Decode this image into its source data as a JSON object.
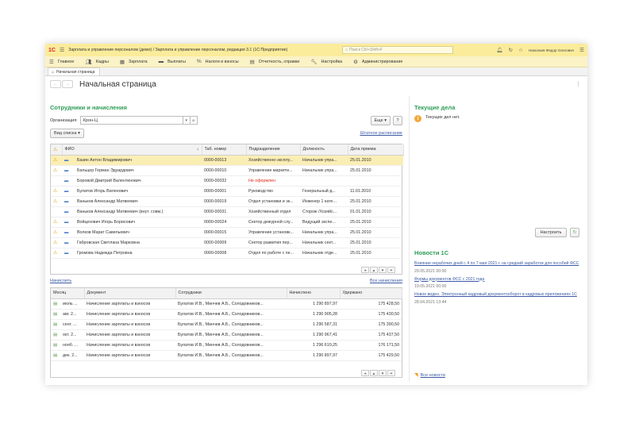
{
  "window": {
    "title": "Зарплата и управление персоналом (демо) / Зарплата и управление персоналом, редакция 3.1  (1С:Предприятие)",
    "search_placeholder": "Поиск Ctrl+Shift+F",
    "user": "Николаев Федор Олегович"
  },
  "menu": [
    {
      "icon": "menu-icon",
      "label": "Главное"
    },
    {
      "icon": "people-icon",
      "label": "Кадры"
    },
    {
      "icon": "calculator-icon",
      "label": "Зарплата"
    },
    {
      "icon": "card-icon",
      "label": "Выплаты"
    },
    {
      "icon": "percent-icon",
      "label": "Налоги и взносы"
    },
    {
      "icon": "report-icon",
      "label": "Отчетность, справки"
    },
    {
      "icon": "wrench-icon",
      "label": "Настройка"
    },
    {
      "icon": "gear-icon",
      "label": "Администрирование"
    }
  ],
  "tab": {
    "label": "Начальная страница"
  },
  "page": {
    "title": "Начальная страница"
  },
  "employees": {
    "title": "Сотрудники и начисления",
    "org_label": "Организация:",
    "org_value": "Крон-Ц",
    "more_button": "Еще",
    "help_button": "?",
    "view_button": "Вид списка",
    "staff_link": "Штатное расписание",
    "columns": [
      "",
      "ФИО",
      "Таб. номер",
      "Подразделение",
      "Должность",
      "Дата приема"
    ],
    "rows": [
      {
        "mark": "warn",
        "name": "Базин Антон Владимирович",
        "num": "0000-00013",
        "dept": "Хозяйственно-эксплу...",
        "pos": "Начальник упра...",
        "date": "25.01.2010",
        "sel": true
      },
      {
        "mark": "warn",
        "name": "Бальцер Герман Эдуардович",
        "num": "0000-00010",
        "dept": "Управление маркети...",
        "pos": "Начальник упра...",
        "date": "25.01.2010"
      },
      {
        "mark": "",
        "name": "Боровой Дмитрий Валентинович",
        "num": "0000-00032",
        "dept": "Не оформлен",
        "pos": "",
        "date": "",
        "red": true
      },
      {
        "mark": "warn",
        "name": "Булатов Игорь Виленович",
        "num": "0000-00001",
        "dept": "Руководство",
        "pos": "Генеральный д...",
        "date": "11.01.2010"
      },
      {
        "mark": "warn",
        "name": "Ваньков Александр Матвеевич",
        "num": "0000-00019",
        "dept": "Отдел установки и эк...",
        "pos": "Инженер 1 кате...",
        "date": "25.01.2010"
      },
      {
        "mark": "",
        "name": "Ваньков Александр Матвеевич (внут. совм.)",
        "num": "0000-00031",
        "dept": "Хозяйственный отдел",
        "pos": "Сторож /Хозяйс...",
        "date": "01.01.2010"
      },
      {
        "mark": "warn",
        "name": "Войцехович Игорь Борисович",
        "num": "0000-00024",
        "dept": "Сектор дежурной слу...",
        "pos": "Ведущий экспе...",
        "date": "25.01.2010"
      },
      {
        "mark": "warn",
        "name": "Волков Марат Савельевич",
        "num": "0000-00015",
        "dept": "Управление установк...",
        "pos": "Начальник упра...",
        "date": "25.01.2010"
      },
      {
        "mark": "warn",
        "name": "Габровская Светлана Марковна",
        "num": "0000-00009",
        "dept": "Сектор развития пер...",
        "pos": "Начальник сект...",
        "date": "25.01.2010"
      },
      {
        "mark": "warn",
        "name": "Громова Надежда Петровна",
        "num": "0000-00008",
        "dept": "Отдел по работе с пе...",
        "pos": "Начальник отде...",
        "date": "25.01.2010"
      }
    ]
  },
  "accruals": {
    "accrue_link": "Начислить",
    "all_link": "Все начисления",
    "columns": [
      "Месяц",
      "Документ",
      "Сотрудники",
      "Начислено",
      "Удержано"
    ],
    "rows": [
      {
        "month": "июль ...",
        "doc": "Начисление зарплаты и взносов",
        "emp": "Булатов И.В., Минчев А.Б., Солодовников...",
        "accrued": "1 290 897,97",
        "withheld": "175 428,50"
      },
      {
        "month": "авг. 2...",
        "doc": "Начисление зарплаты и взносов",
        "emp": "Булатов И.В., Минчев А.Б., Солодовников...",
        "accrued": "1 290 905,28",
        "withheld": "175 430,50"
      },
      {
        "month": "сент. ...",
        "doc": "Начисление зарплаты и взносов",
        "emp": "Булатов И.В., Минчев А.Б., Солодовников...",
        "accrued": "1 290 587,31",
        "withheld": "175 390,50"
      },
      {
        "month": "окт. 2...",
        "doc": "Начисление зарплаты и взносов",
        "emp": "Булатов И.В., Минчев А.Б., Солодовников...",
        "accrued": "1 290 967,41",
        "withheld": "175 437,50"
      },
      {
        "month": "нояб. ...",
        "doc": "Начисление зарплаты и взносов",
        "emp": "Булатов И.В., Минчев А.Б., Солодовников...",
        "accrued": "1 296 610,25",
        "withheld": "176 171,50"
      },
      {
        "month": "дек. 2...",
        "doc": "Начисление зарплаты и взносов",
        "emp": "Булатов И.В., Минчев А.Б., Солодовников...",
        "accrued": "1 290 897,97",
        "withheld": "175 429,50"
      }
    ]
  },
  "tasks": {
    "title": "Текущие дела",
    "empty_text": "Текущих дел нет.",
    "configure_button": "Настроить"
  },
  "news": {
    "title": "Новости 1С",
    "items": [
      {
        "title": "Влияние нерабочих дней с 4 по 7 мая 2021 г. на средний заработок для пособий ФСС",
        "date": "29.05.2021 00:00"
      },
      {
        "title": "Формы документов ФСС с 2021 года",
        "date": "19.05.2021 00:00"
      },
      {
        "title": "Новое видео. Электронный кадровый документооборот в кадровых приложениях 1С",
        "date": "28.04.2021 13:44"
      }
    ],
    "all_link": "Все новости"
  }
}
